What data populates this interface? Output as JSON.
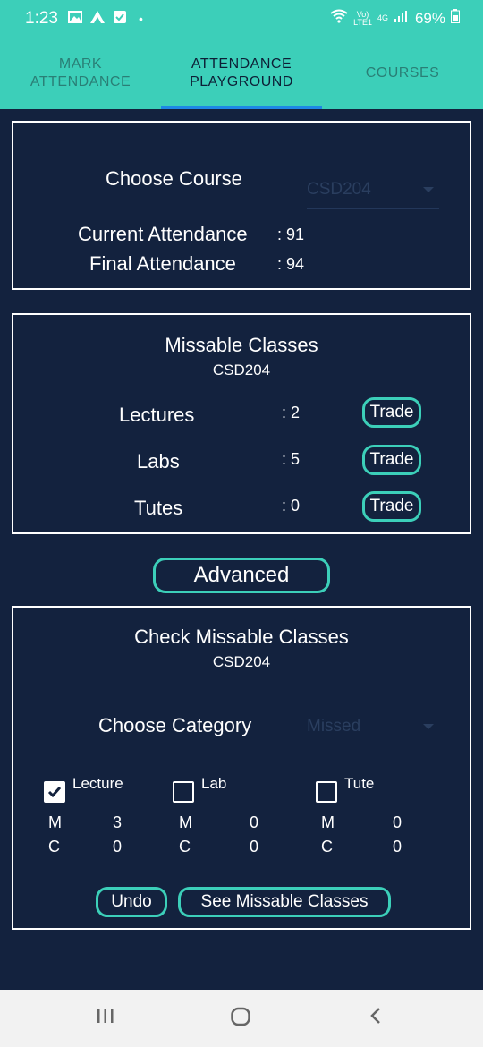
{
  "status_bar": {
    "time": "1:23",
    "volte": "Vo)",
    "lte": "LTE1",
    "network": "4G",
    "battery": "69%"
  },
  "tabs": [
    {
      "label_line1": "MARK",
      "label_line2": "ATTENDANCE"
    },
    {
      "label_line1": "ATTENDANCE",
      "label_line2": "PLAYGROUND"
    },
    {
      "label_line1": "COURSES",
      "label_line2": ""
    }
  ],
  "course_card": {
    "choose_label": "Choose Course",
    "selected_course": "CSD204",
    "current_label": "Current Attendance",
    "current_value": ": 91",
    "final_label": "Final Attendance",
    "final_value": ": 94"
  },
  "missable_card": {
    "title": "Missable Classes",
    "course": "CSD204",
    "rows": [
      {
        "label": "Lectures",
        "value": ": 2",
        "button": "Trade"
      },
      {
        "label": "Labs",
        "value": ": 5",
        "button": "Trade"
      },
      {
        "label": "Tutes",
        "value": ": 0",
        "button": "Trade"
      }
    ]
  },
  "advanced_button": "Advanced",
  "check_card": {
    "title": "Check Missable Classes",
    "course": "CSD204",
    "category_label": "Choose Category",
    "category_value": "Missed",
    "types": [
      {
        "label": "Lecture",
        "checked": true,
        "m_label": "M",
        "m_value": "3",
        "c_label": "C",
        "c_value": "0"
      },
      {
        "label": "Lab",
        "checked": false,
        "m_label": "M",
        "m_value": "0",
        "c_label": "C",
        "c_value": "0"
      },
      {
        "label": "Tute",
        "checked": false,
        "m_label": "M",
        "m_value": "0",
        "c_label": "C",
        "c_value": "0"
      }
    ],
    "undo_button": "Undo",
    "see_button": "See Missable Classes"
  },
  "colors": {
    "accent": "#3ccfb9",
    "background": "#13223e",
    "tab_indicator": "#1e88e5"
  }
}
